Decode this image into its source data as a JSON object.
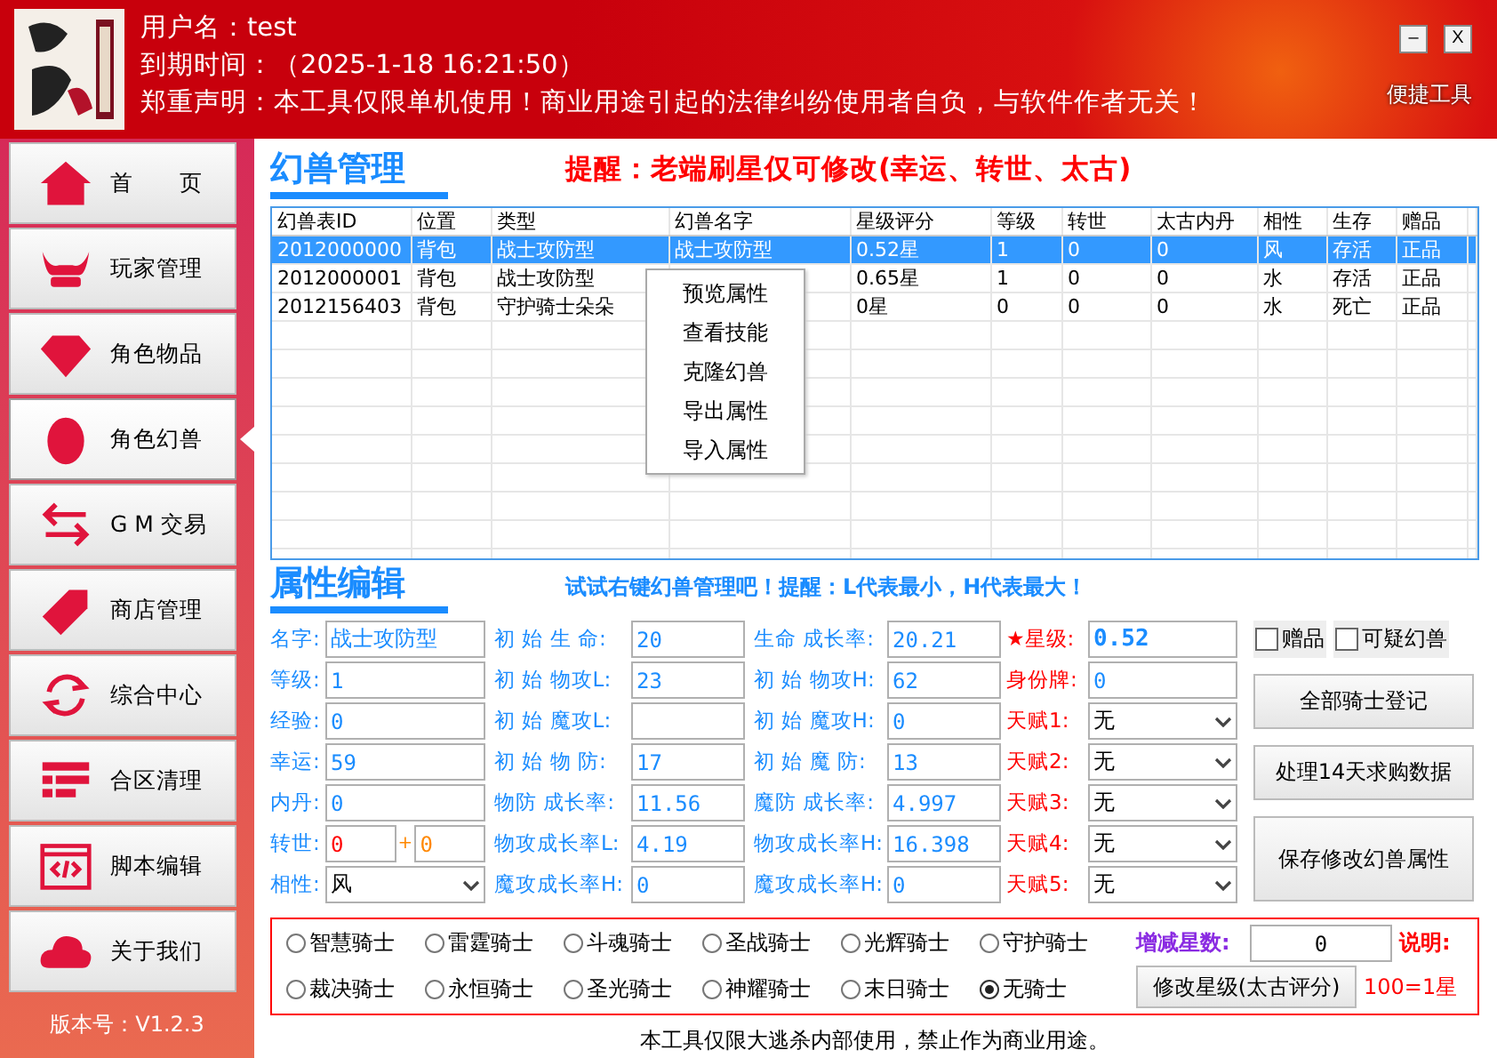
{
  "header": {
    "user": "用户名：test",
    "expiry": "到期时间：（2025-1-18 16:21:50）",
    "disclaimer": "郑重声明：本工具仅限单机使用！商业用途引起的法律纠纷使用者自负，与软件作者无关！",
    "minimize": "–",
    "close": "X",
    "quick_tools": "便捷工具"
  },
  "sidebar": {
    "items": [
      {
        "label": "首　　页",
        "selected": false
      },
      {
        "label": "玩家管理",
        "selected": false
      },
      {
        "label": "角色物品",
        "selected": false
      },
      {
        "label": "角色幻兽",
        "selected": true
      },
      {
        "label": "G M 交易",
        "selected": false
      },
      {
        "label": "商店管理",
        "selected": false
      },
      {
        "label": "综合中心",
        "selected": false
      },
      {
        "label": "合区清理",
        "selected": false
      },
      {
        "label": "脚本编辑",
        "selected": false
      },
      {
        "label": "关于我们",
        "selected": false
      }
    ],
    "version": "版本号：V1.2.3"
  },
  "pet_manager": {
    "title": "幻兽管理",
    "notice": "提醒：老端刷星仅可修改(幸运、转世、太古)",
    "table": {
      "columns": [
        "幻兽表ID",
        "位置",
        "类型",
        "幻兽名字",
        "星级评分",
        "等级",
        "转世",
        "太古内丹",
        "相性",
        "生存",
        "赠品"
      ],
      "rows": [
        {
          "selected": true,
          "cells": [
            "2012000000",
            "背包",
            "战士攻防型",
            "战士攻防型",
            "0.52星",
            "1",
            "0",
            "0",
            "风",
            "存活",
            "正品"
          ]
        },
        {
          "selected": false,
          "cells": [
            "2012000001",
            "背包",
            "战士攻防型",
            null,
            "0.65星",
            "1",
            "0",
            "0",
            "水",
            "存活",
            "正品"
          ]
        },
        {
          "selected": false,
          "cells": [
            "2012156403",
            "背包",
            "守护骑士朵朵",
            null,
            "0星",
            "0",
            "0",
            "0",
            "水",
            "死亡",
            "正品"
          ]
        }
      ]
    },
    "context_menu": [
      "预览属性",
      "查看技能",
      "克隆幻兽",
      "导出属性",
      "导入属性"
    ]
  },
  "attribute_editor": {
    "title": "属性编辑",
    "hint": "试试右键幻兽管理吧！提醒：L代表最小，H代表最大！",
    "rows": [
      [
        {
          "kind": "text",
          "label": "名字:",
          "value": "战士攻防型"
        },
        {
          "kind": "text",
          "label": "初 始 生 命:",
          "value": "20"
        },
        {
          "kind": "text",
          "label": "生命 成长率:",
          "value": "20.21"
        },
        {
          "kind": "text",
          "label": "★星级:",
          "value": "0.52",
          "alert": true,
          "emphasis": true
        }
      ],
      [
        {
          "kind": "text",
          "label": "等级:",
          "value": "1"
        },
        {
          "kind": "text",
          "label": "初 始 物攻L:",
          "value": "23"
        },
        {
          "kind": "text",
          "label": "初 始 物攻H:",
          "value": "62"
        },
        {
          "kind": "text",
          "label": "身份牌:",
          "value": "0",
          "alert": true
        }
      ],
      [
        {
          "kind": "text",
          "label": "经验:",
          "value": "0"
        },
        {
          "kind": "text",
          "label": "初 始 魔攻L:"
        },
        {
          "kind": "text",
          "label": "初 始 魔攻H:",
          "value": "0"
        },
        {
          "kind": "select",
          "label": "天赋1:",
          "value": "无",
          "alert": true
        }
      ],
      [
        {
          "kind": "text",
          "label": "幸运:",
          "value": "59"
        },
        {
          "kind": "text",
          "label": "初 始 物 防:",
          "value": "17"
        },
        {
          "kind": "text",
          "label": "初 始 魔 防:",
          "value": "13"
        },
        {
          "kind": "select",
          "label": "天赋2:",
          "value": "无",
          "alert": true
        }
      ],
      [
        {
          "kind": "text",
          "label": "内丹:",
          "value": "0"
        },
        {
          "kind": "text",
          "label": "物防 成长率:",
          "value": "11.56"
        },
        {
          "kind": "text",
          "label": "魔防 成长率:",
          "value": "4.997"
        },
        {
          "kind": "select",
          "label": "天赋3:",
          "value": "无",
          "alert": true
        }
      ],
      [
        {
          "kind": "pair",
          "label": "转世:",
          "value": "0",
          "plus": "+",
          "value2": "0"
        },
        {
          "kind": "text",
          "label": "物攻成长率L:",
          "value": "4.19"
        },
        {
          "kind": "text",
          "label": "物攻成长率H:",
          "value": "16.398"
        },
        {
          "kind": "select",
          "label": "天赋4:",
          "value": "无",
          "alert": true
        }
      ],
      [
        {
          "kind": "select",
          "label": "相性:",
          "value": "风"
        },
        {
          "kind": "text",
          "label": "魔攻成长率H:",
          "value": "0"
        },
        {
          "kind": "text",
          "label": "魔攻成长率H:",
          "value": "0"
        },
        {
          "kind": "select",
          "label": "天赋5:",
          "value": "无",
          "alert": true
        }
      ]
    ],
    "checkboxes": [
      {
        "label": "赠品",
        "checked": false
      },
      {
        "label": "可疑幻兽",
        "checked": false
      }
    ],
    "buttons": [
      "全部骑士登记",
      "处理14天求购数据",
      "保存修改幻兽属性"
    ]
  },
  "knights": {
    "options": [
      {
        "label": "智慧骑士",
        "selected": false
      },
      {
        "label": "雷霆骑士",
        "selected": false
      },
      {
        "label": "斗魂骑士",
        "selected": false
      },
      {
        "label": "圣战骑士",
        "selected": false
      },
      {
        "label": "光辉骑士",
        "selected": false
      },
      {
        "label": "守护骑士",
        "selected": false
      },
      {
        "label": "裁决骑士",
        "selected": false
      },
      {
        "label": "永恒骑士",
        "selected": false
      },
      {
        "label": "圣光骑士",
        "selected": false
      },
      {
        "label": "神耀骑士",
        "selected": false
      },
      {
        "label": "末日骑士",
        "selected": false
      },
      {
        "label": "无骑士",
        "selected": true
      }
    ],
    "star_delta_label": "增减星数:",
    "star_delta_value": "0",
    "note_label": "说明:",
    "modify_button": "修改星级(太古评分)",
    "note_text": "100=1星"
  },
  "footer": "本工具仅限大逃杀内部使用，禁止作为商业用途。"
}
